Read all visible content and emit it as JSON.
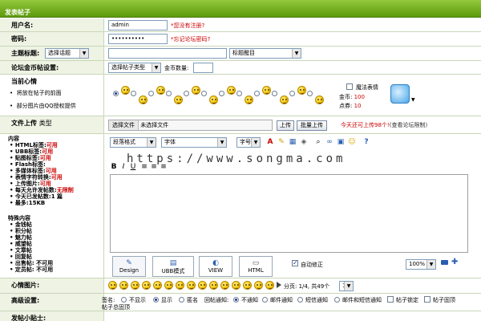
{
  "title": "发表帖子",
  "username": {
    "label": "用户名:",
    "value": "admin",
    "hint": "*您没有注册?"
  },
  "password": {
    "label": "密码:",
    "value": "••••••••••",
    "hint": "*忘记论坛密码?"
  },
  "subject": {
    "label": "主题标题:",
    "topic_select": "选择话题",
    "value": "",
    "tag_select": "标题醒目"
  },
  "forum_coin": {
    "label": "论坛金币帖设置:",
    "type_select": "选择帖子类型",
    "coin_label": "金币数量:",
    "value": ""
  },
  "mood": {
    "label": "当前心情",
    "notes": [
      "将放在帖子的前面",
      "部分图片由QQ授权提供"
    ],
    "magic_label": "魔法表情",
    "coins_label": "金币:",
    "coins": "100",
    "points_label": "点券:",
    "points": "10"
  },
  "upload": {
    "label": "文件上传",
    "type_label": "类型",
    "choose_label": "选择文件",
    "no_file": "未选择文件",
    "upload_button": "上传",
    "batch_upload_button": "批量上传",
    "note": "今天还可上传98个!",
    "note_link": "(查看论坛限制)"
  },
  "content": {
    "label": "内容",
    "rules": [
      {
        "k": "HTML标签:",
        "v": "可用"
      },
      {
        "k": "UBB标签:",
        "v": "可用"
      },
      {
        "k": "贴图标签:",
        "v": "可用"
      },
      {
        "k": "Flash标签:",
        "v": ""
      },
      {
        "k": "多媒体标签:",
        "v": "可用"
      },
      {
        "k": "表情字符转换:",
        "v": "可用"
      },
      {
        "k": "上传图片:",
        "v": "可用"
      },
      {
        "k": "每天允许发帖数:",
        "v": "无限制"
      },
      {
        "k": "今天已发帖数:",
        "v": "1 篇"
      },
      {
        "k": "最多:",
        "v": "15KB"
      }
    ],
    "special_label": "特殊内容",
    "special": [
      "金钱帖",
      "积分帖",
      "魅力帖",
      "威望帖",
      "文章帖",
      "回复帖",
      "出售帖: 不可用",
      "定员帖: 不可用"
    ]
  },
  "toolbar": {
    "paragraph": "段落格式",
    "font": "字体",
    "size": "字号",
    "watermark": "https://www.songma.com"
  },
  "modes": [
    {
      "label": "Design"
    },
    {
      "label": "UBB模式"
    },
    {
      "label": "VIEW"
    },
    {
      "label": "HTML"
    }
  ],
  "autofix": "自动修正",
  "zoom": "100%",
  "mood_images": {
    "label": "心情图片:",
    "pager": "分页: 1/4, 共49个",
    "page": "1"
  },
  "advanced": {
    "label": "高级设置:",
    "signature_label": "签名:",
    "sig_options": [
      "不显示",
      "显示",
      "匿名"
    ],
    "reply_label": "回帖通知:",
    "reply_options": [
      "不通知",
      "邮件通知",
      "短信通知",
      "邮件和短信通知"
    ],
    "lock_label": "帖子锁定",
    "top_label": "帖子固顶",
    "total_top": "帖子总固顶"
  },
  "tips": {
    "label": "发帖小贴士:"
  }
}
